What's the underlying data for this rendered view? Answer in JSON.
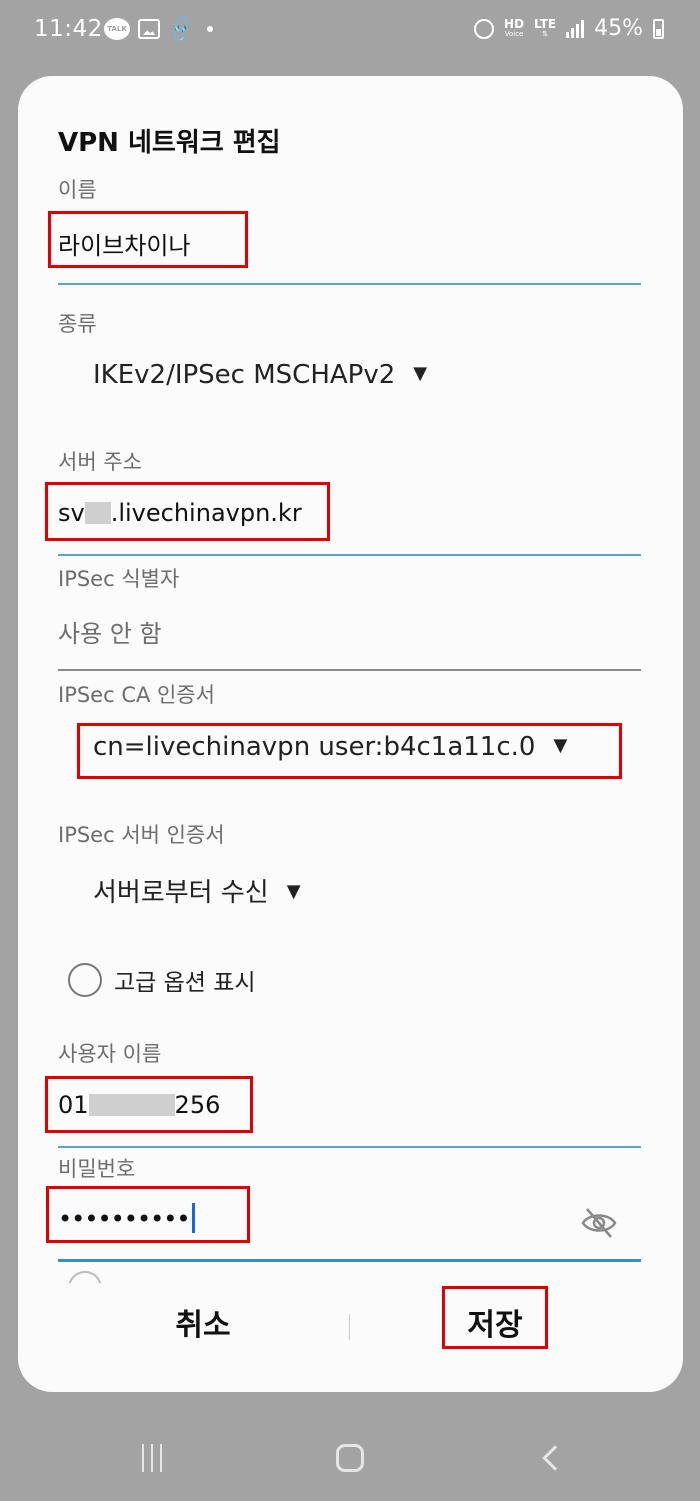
{
  "status_bar": {
    "time": "11:42",
    "talk_icon_text": "TALK",
    "network_hd": "HD",
    "network_voice": "Voice",
    "network_lte": "LTE",
    "battery": "45%"
  },
  "dialog": {
    "title": "VPN 네트워크 편집",
    "name": {
      "label": "이름",
      "value": "라이브차이나"
    },
    "type": {
      "label": "종류",
      "value": "IKEv2/IPSec MSCHAPv2"
    },
    "server": {
      "label": "서버 주소",
      "value_prefix": "sv",
      "value_suffix": ".livechinavpn.kr"
    },
    "ipsec_id": {
      "label": "IPSec 식별자",
      "value": "사용 안 함"
    },
    "ipsec_ca": {
      "label": "IPSec CA 인증서",
      "value": "cn=livechinavpn user:b4c1a11c.0"
    },
    "ipsec_server_cert": {
      "label": "IPSec 서버 인증서",
      "value": "서버로부터 수신"
    },
    "advanced": {
      "label": "고급 옵션 표시",
      "checked": false
    },
    "username": {
      "label": "사용자 이름",
      "value_prefix": "01",
      "value_suffix": "256"
    },
    "password": {
      "label": "비밀번호",
      "value": "••••••••••"
    },
    "cancel_label": "취소",
    "save_label": "저장"
  },
  "colors": {
    "highlight_box": "#e10000",
    "active_underline": "#5fa2c4",
    "cursor": "#1b66d6"
  },
  "icons": {
    "password_toggle": "eye-off-icon",
    "dropdown": "triangle-down-icon"
  }
}
